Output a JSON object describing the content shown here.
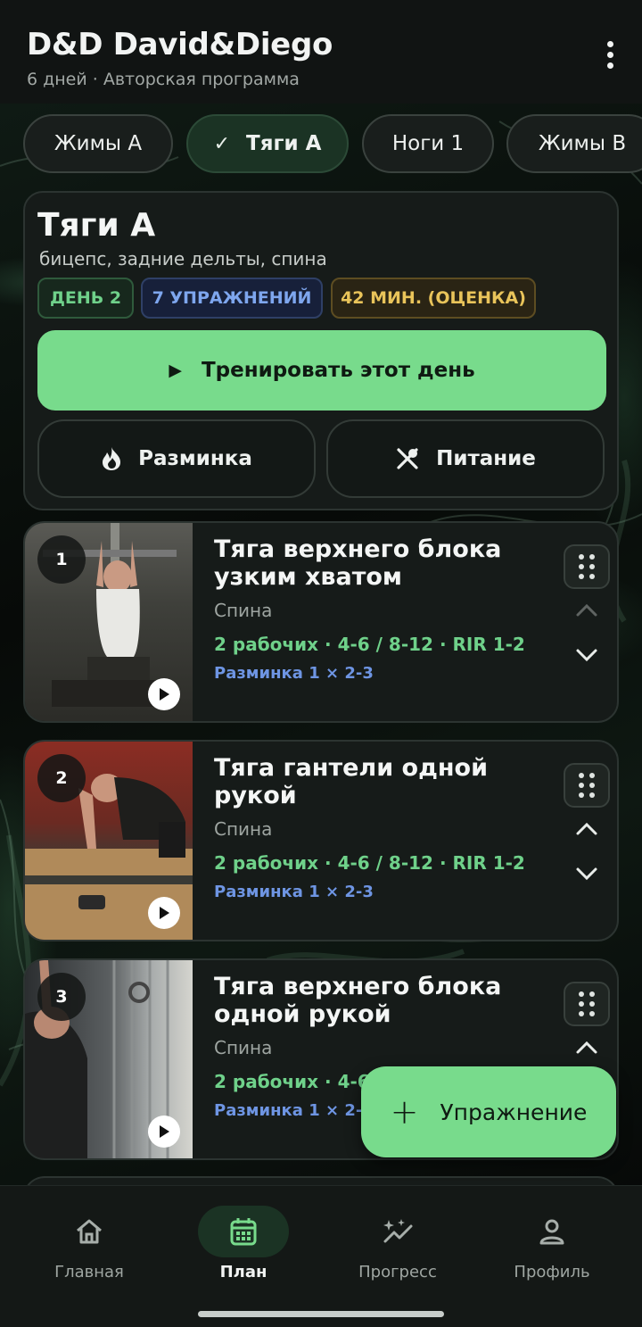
{
  "header": {
    "title": "D&D David&Diego",
    "subtitle": "6 дней · Авторская программа",
    "menu_icon": "more-vert-icon"
  },
  "tabs": [
    {
      "label": "Жимы A",
      "active": false
    },
    {
      "label": "Тяги A",
      "active": true
    },
    {
      "label": "Ноги 1",
      "active": false
    },
    {
      "label": "Жимы B",
      "active": false
    }
  ],
  "day": {
    "title": "Тяги A",
    "muscles": "бицепс, задние дельты, спина",
    "chips": {
      "day": "ДЕНЬ 2",
      "exercises": "7 УПРАЖНЕНИЙ",
      "duration": "42 МИН. (ОЦЕНКА)"
    },
    "train_label": "Тренировать этот день",
    "warmup_label": "Разминка",
    "nutrition_label": "Питание"
  },
  "exercises": [
    {
      "num": "1",
      "name": "Тяга верхнего блока узким хватом",
      "muscle": "Спина",
      "sets": "2 рабочих · 4-6 / 8-12 · RIR 1-2",
      "warmup": "Разминка 1 × 2-3"
    },
    {
      "num": "2",
      "name": "Тяга гантели одной рукой",
      "muscle": "Спина",
      "sets": "2 рабочих · 4-6 / 8-12 · RIR 1-2",
      "warmup": "Разминка 1 × 2-3"
    },
    {
      "num": "3",
      "name": "Тяга верхнего блока одной рукой",
      "muscle": "Спина",
      "sets": "2 рабочих · 4-6",
      "warmup": "Разминка 1 × 2-3"
    }
  ],
  "fab": {
    "label": "Упражнение"
  },
  "nav": [
    {
      "label": "Главная",
      "icon": "home-icon",
      "active": false
    },
    {
      "label": "План",
      "icon": "calendar-icon",
      "active": true
    },
    {
      "label": "Прогресс",
      "icon": "sparkle-chart-icon",
      "active": false
    },
    {
      "label": "Профиль",
      "icon": "person-icon",
      "active": false
    }
  ],
  "colors": {
    "accent": "#78db8c",
    "chip_green": "#6fd18a",
    "chip_blue": "#7ea6ee",
    "chip_yellow": "#e9c45a",
    "card_bg": "#161b19"
  }
}
